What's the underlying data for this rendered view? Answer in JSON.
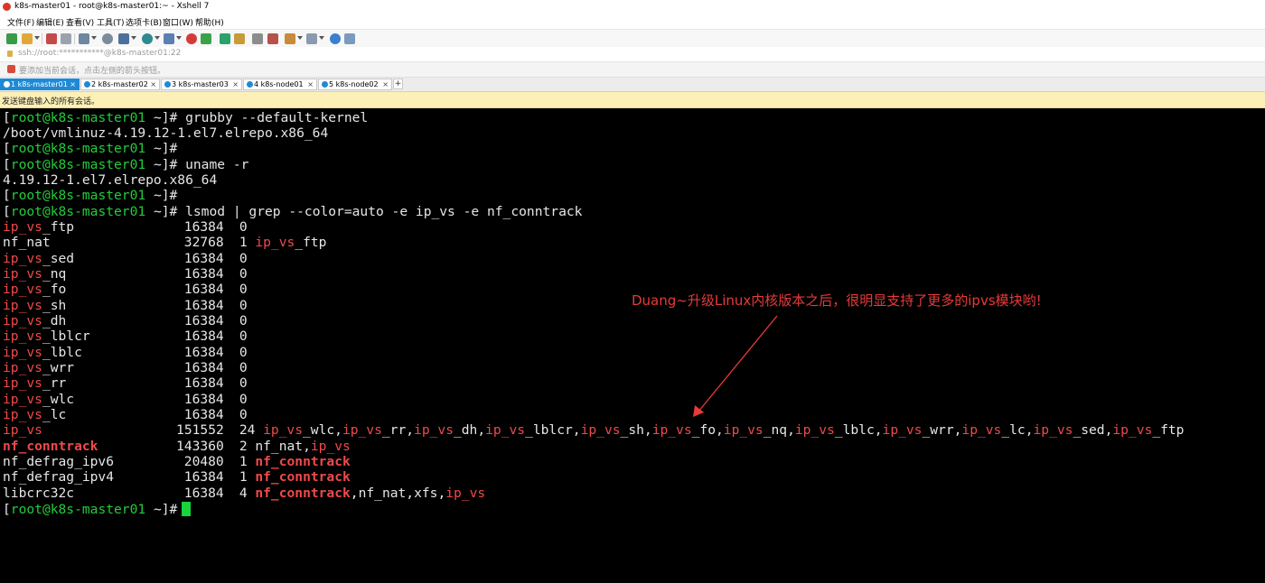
{
  "window": {
    "title": "k8s-master01 - root@k8s-master01:~ - Xshell 7"
  },
  "menu": [
    "文件(F)",
    "编辑(E)",
    "查看(V)",
    "工具(T)",
    "选项卡(B)",
    "窗口(W)",
    "帮助(H)"
  ],
  "address": {
    "url": "ssh://root:***********@k8s-master01:22"
  },
  "session_hint": "要添加当前会话，点击左侧的箭头按钮。",
  "tabs": [
    {
      "label": "1 k8s-master01",
      "active": true
    },
    {
      "label": "2 k8s-master02",
      "active": false
    },
    {
      "label": "3 k8s-master03",
      "active": false
    },
    {
      "label": "4 k8s-node01",
      "active": false
    },
    {
      "label": "5 k8s-node02",
      "active": false
    }
  ],
  "add_tab": "+",
  "notice": "发送键盘输入的所有会话。",
  "terminal": {
    "prompt": {
      "bracket_open": "[",
      "user_host": "root@k8s-master01",
      "path": " ~",
      "bracket_close": "]#"
    },
    "commands": {
      "grubby": " grubby --default-kernel",
      "uname": " uname -r",
      "lsmod": " lsmod | grep --color=auto -e ip_vs -e nf_conntrack"
    },
    "outputs": {
      "kernel_path": "/boot/vmlinuz-4.19.12-1.el7.elrepo.x86_64",
      "kernel_release": "4.19.12-1.el7.elrepo.x86_64"
    },
    "modules": [
      {
        "hl": "ip_vs",
        "rest": "_ftp",
        "size": "16384",
        "used": "0",
        "by": ""
      },
      {
        "hl": "",
        "rest": "nf_nat",
        "size": "32768",
        "used": "1",
        "by": "ip_vs_ftp"
      },
      {
        "hl": "ip_vs",
        "rest": "_sed",
        "size": "16384",
        "used": "0",
        "by": ""
      },
      {
        "hl": "ip_vs",
        "rest": "_nq",
        "size": "16384",
        "used": "0",
        "by": ""
      },
      {
        "hl": "ip_vs",
        "rest": "_fo",
        "size": "16384",
        "used": "0",
        "by": ""
      },
      {
        "hl": "ip_vs",
        "rest": "_sh",
        "size": "16384",
        "used": "0",
        "by": ""
      },
      {
        "hl": "ip_vs",
        "rest": "_dh",
        "size": "16384",
        "used": "0",
        "by": ""
      },
      {
        "hl": "ip_vs",
        "rest": "_lblcr",
        "size": "16384",
        "used": "0",
        "by": ""
      },
      {
        "hl": "ip_vs",
        "rest": "_lblc",
        "size": "16384",
        "used": "0",
        "by": ""
      },
      {
        "hl": "ip_vs",
        "rest": "_wrr",
        "size": "16384",
        "used": "0",
        "by": ""
      },
      {
        "hl": "ip_vs",
        "rest": "_rr",
        "size": "16384",
        "used": "0",
        "by": ""
      },
      {
        "hl": "ip_vs",
        "rest": "_wlc",
        "size": "16384",
        "used": "0",
        "by": ""
      },
      {
        "hl": "ip_vs",
        "rest": "_lc",
        "size": "16384",
        "used": "0",
        "by": ""
      },
      {
        "hl": "ip_vs",
        "rest": "",
        "size": "151552",
        "used": "24",
        "by": "ip_vs_wlc,ip_vs_rr,ip_vs_dh,ip_vs_lblcr,ip_vs_sh,ip_vs_fo,ip_vs_nq,ip_vs_lblc,ip_vs_wrr,ip_vs_lc,ip_vs_sed,ip_vs_ftp"
      },
      {
        "hl": "nf_conntrack",
        "rest": "",
        "size": "143360",
        "used": "2",
        "by": "nf_nat,ip_vs"
      },
      {
        "hl": "",
        "rest": "nf_defrag_ipv6",
        "size": "20480",
        "used": "1",
        "by": "nf_conntrack"
      },
      {
        "hl": "",
        "rest": "nf_defrag_ipv4",
        "size": "16384",
        "used": "1",
        "by": "nf_conntrack"
      },
      {
        "hl": "",
        "rest": "libcrc32c",
        "size": "16384",
        "used": "4",
        "by": "nf_conntrack,nf_nat,xfs,ip_vs"
      }
    ]
  },
  "annotation": "Duang~升级Linux内核版本之后，很明显支持了更多的ipvs模块哟!",
  "colors": {
    "prompt_green": "#24cc3a",
    "highlight_red": "#ef4a4a",
    "annotation_red": "#e83a3a",
    "terminal_bg": "#000000",
    "cursor_green": "#19d43a",
    "tab_active_blue": "#1e8ad6",
    "notice_yellow": "#fdf0b6"
  }
}
